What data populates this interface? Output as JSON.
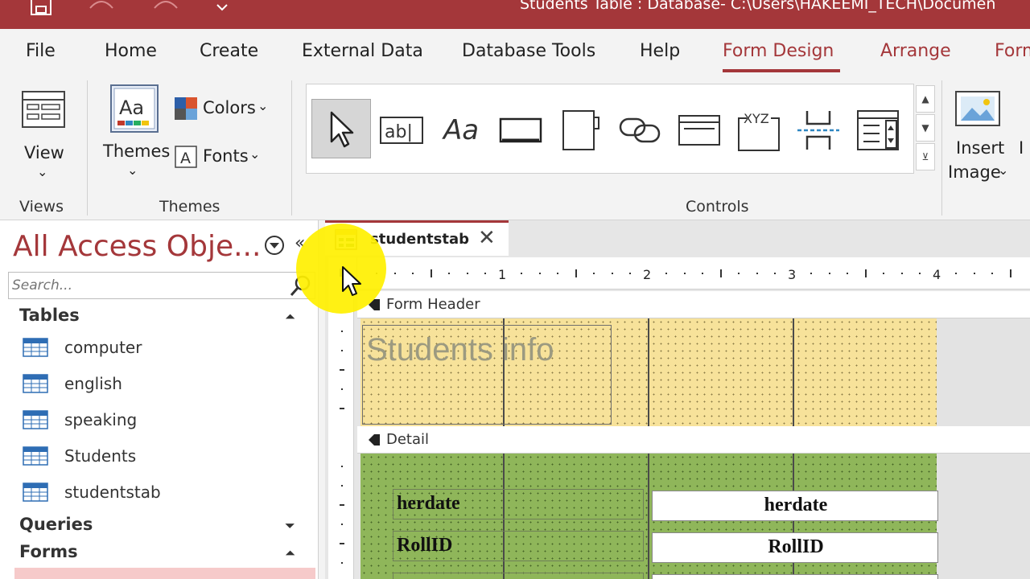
{
  "window": {
    "title": "Students Table : Database- C:\\Users\\HAKEEMI_TECH\\Documen"
  },
  "ribbon_tabs": [
    {
      "label": "File"
    },
    {
      "label": "Home"
    },
    {
      "label": "Create"
    },
    {
      "label": "External Data"
    },
    {
      "label": "Database Tools"
    },
    {
      "label": "Help"
    },
    {
      "label": "Form Design",
      "active": true
    },
    {
      "label": "Arrange"
    },
    {
      "label": "Form"
    }
  ],
  "ribbon": {
    "view_label": "View",
    "views_group": "Views",
    "themes_label": "Themes",
    "colors_label": "Colors",
    "fonts_label": "Fonts",
    "themes_group": "Themes",
    "controls_group": "Controls",
    "insert_label": "Insert",
    "image_label": "Image",
    "partial_label": "I",
    "textbox_text": "ab|",
    "label_text": "Aa",
    "xyz_text": "XYZ",
    "dropdown_glyph": "⌄"
  },
  "nav": {
    "title": "All Access Obje...",
    "search_placeholder": "Search...",
    "groups": [
      {
        "label": "Tables",
        "collapsed": false
      },
      {
        "label": "Queries",
        "collapsed": true
      },
      {
        "label": "Forms",
        "collapsed": false
      }
    ],
    "tables": [
      {
        "label": "computer"
      },
      {
        "label": "english"
      },
      {
        "label": "speaking"
      },
      {
        "label": "Students"
      },
      {
        "label": "studentstab"
      }
    ]
  },
  "document": {
    "tab_label": "studentstab",
    "ruler_numbers": [
      "1",
      "2",
      "3",
      "4"
    ],
    "form_header_label": "Form Header",
    "detail_label": "Detail",
    "title_text": "Students info",
    "fields": [
      {
        "label": "herdate",
        "value": "herdate"
      },
      {
        "label": "RollID",
        "value": "RollID"
      }
    ]
  },
  "colors": {
    "accent": "#a4373a",
    "header_fill": "#f7e29a",
    "detail_fill": "#8fb65a",
    "highlight": "#fff000"
  }
}
